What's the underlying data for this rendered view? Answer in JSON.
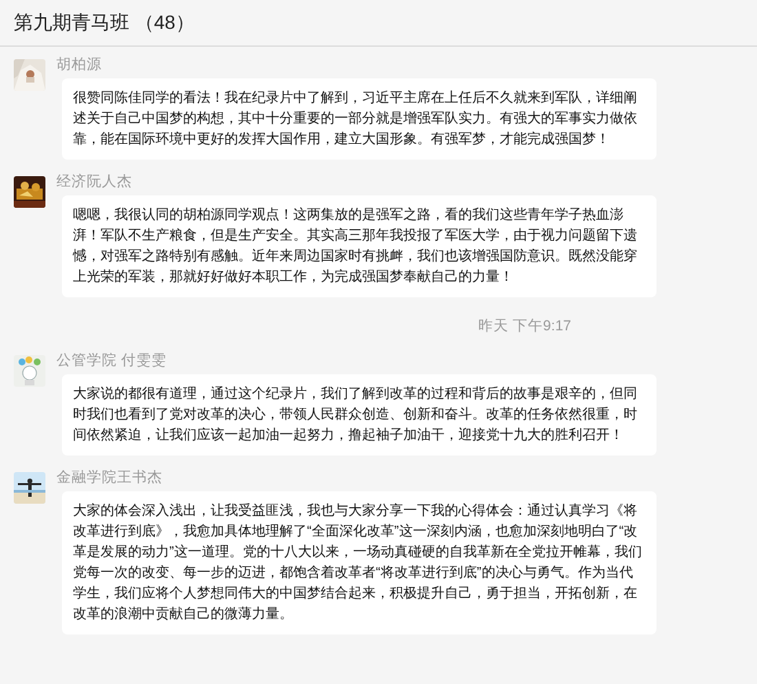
{
  "window": {
    "title": "第九期青马班 （48）"
  },
  "items": [
    {
      "kind": "message",
      "sender": "胡柏源",
      "text": "很赞同陈佳同学的看法！我在纪录片中了解到，习近平主席在上任后不久就来到军队，详细阐述关于自己中国梦的构想，其中十分重要的一部分就是增强军队实力。有强大的军事实力做依靠，能在国际环境中更好的发挥大国作用，建立大国形象。有强军梦，才能完成强国梦！"
    },
    {
      "kind": "message",
      "sender": "经济阮人杰",
      "text": "嗯嗯，我很认同的胡柏源同学观点！这两集放的是强军之路，看的我们这些青年学子热血澎湃！军队不生产粮食，但是生产安全。其实高三那年我投报了军医大学，由于视力问题留下遗憾，对强军之路特别有感触。近年来周边国家时有挑衅，我们也该增强国防意识。既然没能穿上光荣的军装，那就好好做好本职工作，为完成强国梦奉献自己的力量！"
    },
    {
      "kind": "time",
      "text": "昨天 下午9:17"
    },
    {
      "kind": "message",
      "sender": "公管学院 付雯雯",
      "text": "大家说的都很有道理，通过这个纪录片，我们了解到改革的过程和背后的故事是艰辛的，但同时我们也看到了党对改革的决心，带领人民群众创造、创新和奋斗。改革的任务依然很重，时间依然紧迫，让我们应该一起加油一起努力，撸起袖子加油干，迎接党十九大的胜利召开！"
    },
    {
      "kind": "message",
      "sender": "金融学院王书杰",
      "text": "大家的体会深入浅出，让我受益匪浅，我也与大家分享一下我的心得体会：通过认真学习《将改革进行到底》，我愈加具体地理解了“全面深化改革”这一深刻内涵，也愈加深刻地明白了“改革是发展的动力”这一道理。党的十八大以来，一场动真碰硬的自我革新在全党拉开帷幕，我们党每一次的改变、每一步的迈进，都饱含着改革者“将改革进行到底”的决心与勇气。作为当代学生，我们应将个人梦想同伟大的中国梦结合起来，积极提升自己，勇于担当，开拓创新，在改革的浪潮中贡献自己的微薄力量。"
    }
  ]
}
